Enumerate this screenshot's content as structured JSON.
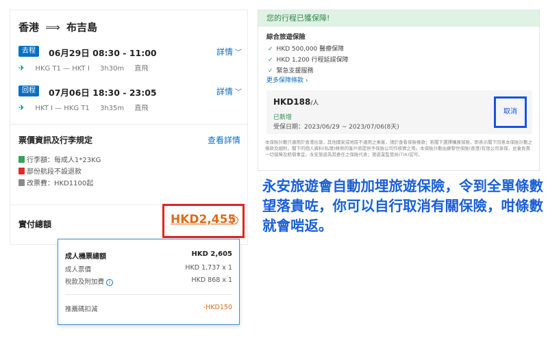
{
  "booking": {
    "route": {
      "origin": "香港",
      "arrow": "⟹",
      "destination": "布吉島"
    },
    "outbound": {
      "tag": "去程",
      "datetime": "06月29日  08:30 - 11:00",
      "detail_label": "詳情",
      "route": "HKG T1 — HKT I",
      "duration": "3h30m",
      "type": "直飛"
    },
    "return": {
      "tag": "回程",
      "datetime": "07月06日  18:30 - 23:05",
      "detail_label": "詳情",
      "route": "HKT I — HKG T1",
      "duration": "3h35m",
      "type": "直飛"
    },
    "fare_rules": {
      "title": "票價資訊及行李規定",
      "link": "查看詳情",
      "items": [
        {
          "icon": "luggage-icon",
          "text": "行李額：每成人1*23KG"
        },
        {
          "icon": "no-refund-icon",
          "text": "部份航段不設退款"
        },
        {
          "icon": "change-fee-icon",
          "text": "改票費：HKD1100起"
        }
      ]
    },
    "total": {
      "label": "實付總額",
      "amount": "HKD2,455"
    }
  },
  "breakdown": {
    "rows": [
      {
        "label": "成人機票總額",
        "value": "HKD 2,605"
      },
      {
        "label": "成人票價",
        "value": "HKD 1,737 x 1"
      },
      {
        "label": "稅款及附加費",
        "value": "HKD 868 x 1"
      }
    ],
    "promo": {
      "label": "推薦碼扣減",
      "value": "-HKD150"
    }
  },
  "insurance": {
    "banner": "您的行程已獲保障!",
    "subtitle": "綜合旅遊保險",
    "items": [
      "HKD 500,000 醫療保障",
      "HKD 1,200 行程延誤保障",
      "緊急支援服務"
    ],
    "more_link": "更多保障條款",
    "price": "HKD188",
    "per": "/人",
    "status": "已新增",
    "dates": "受保日期：2023/06/29 ~ 2023/07/06(8天)",
    "cancel_label": "取消",
    "fine_print": "本保險計劃只適用於香港出發，其他國家或地區不適用之乘客，請於查看保險條款；若閣下選擇購買保險，即表示閣下同意本保險計劃之條款及細則，閣下的個人資料(私隱)條例的客戶將提供予保險公司作核實之用。本保險計劃由蘇黎世保險(香港)有限公司承保，並會負責一切保障及賠償事宜。永安旅遊為其委任之保險代表；旅遊業監管局(TIA)認可。"
  },
  "commentary": "永安旅遊會自動加埋旅遊保險，令到全單條數望落貴咗，你可以自行取消有關保險，咁條數就會啱返。",
  "colors": {
    "accent_blue": "#0a6fc2",
    "highlight_red": "#e0241c",
    "price_orange": "#e06a1b",
    "insurance_green": "#2f8a4a",
    "commentary_blue": "#1a5fd6"
  }
}
